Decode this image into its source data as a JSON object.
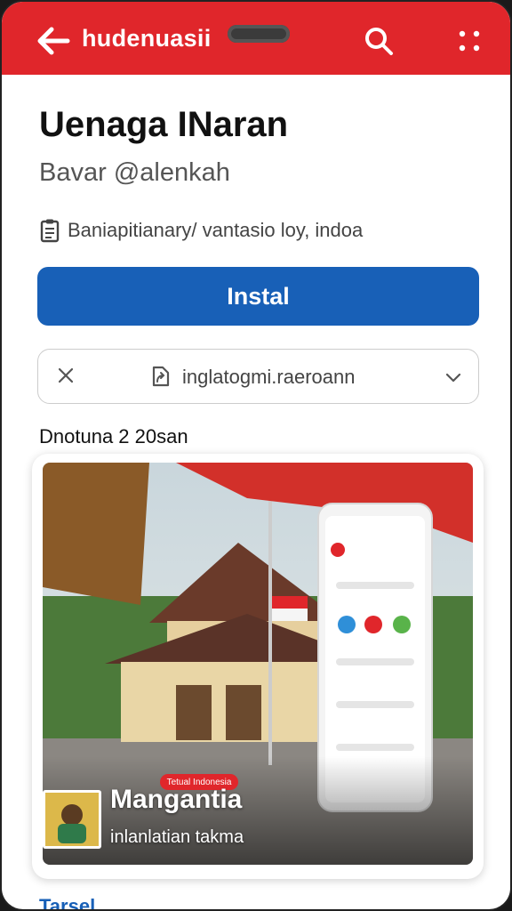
{
  "header": {
    "title": "hudenuasii"
  },
  "app": {
    "name": "Uenaga INaran",
    "developer": "Bavar @alenkah",
    "meta": "Baniapitianary/ vantasio loy, indoa"
  },
  "install": {
    "label": "Instal"
  },
  "selector": {
    "label": "inglatogmi.raeroann"
  },
  "section": {
    "label": "Dnotuna 2 20san"
  },
  "feature": {
    "badge": "Tetual Indonesia",
    "title": "Mangantia",
    "subtitle": "inlanlatian takma"
  },
  "footer": {
    "label": "Tarsel"
  },
  "colors": {
    "primary": "#e0262b",
    "accent": "#1860b7"
  }
}
